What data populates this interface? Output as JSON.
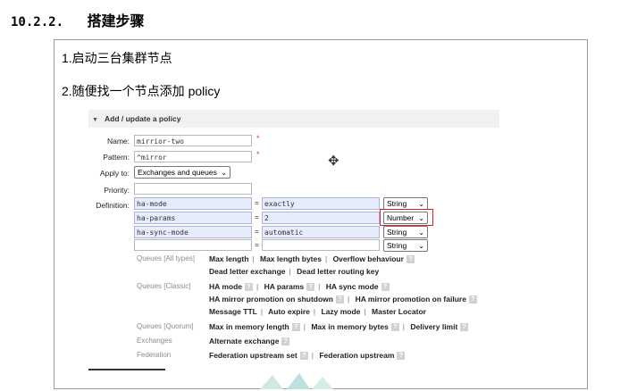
{
  "heading": {
    "number": "10.2.2.",
    "title": "搭建步骤"
  },
  "steps": [
    "1.启动三台集群节点",
    "2.随便找一个节点添加 policy"
  ],
  "panel": {
    "title": "Add / update a policy"
  },
  "form": {
    "name_label": "Name:",
    "name_value": "mirrior-two",
    "pattern_label": "Pattern:",
    "pattern_value": "^mirror",
    "required_mark": "*",
    "apply_label": "Apply to:",
    "apply_value": "Exchanges and queues",
    "priority_label": "Priority:",
    "priority_value": "",
    "definition_label": "Definition:",
    "definitions": [
      {
        "key": "ha-mode",
        "value": "exactly",
        "type": "String"
      },
      {
        "key": "ha-params",
        "value": "2",
        "type": "Number"
      },
      {
        "key": "ha-sync-mode",
        "value": "automatic",
        "type": "String"
      },
      {
        "key": "",
        "value": "",
        "type": "String"
      }
    ],
    "equals": "="
  },
  "option_groups": [
    {
      "category": "Queues [All types]",
      "lines": [
        [
          "Max length",
          "Max length bytes",
          "Overflow behaviour ?"
        ],
        [
          "Dead letter exchange",
          "Dead letter routing key"
        ]
      ]
    },
    {
      "category": "Queues [Classic]",
      "lines": [
        [
          "HA mode ?",
          "HA params ?",
          "HA sync mode ?"
        ],
        [
          "HA mirror promotion on shutdown ?",
          "HA mirror promotion on failure ?"
        ],
        [
          "Message TTL",
          "Auto expire",
          "Lazy mode",
          "Master Locator"
        ]
      ]
    },
    {
      "category": "Queues [Quorum]",
      "lines": [
        [
          "Max in memory length ?",
          "Max in memory bytes ?",
          "Delivery limit ?"
        ]
      ]
    },
    {
      "category": "Exchanges",
      "lines": [
        [
          "Alternate exchange ?"
        ]
      ]
    },
    {
      "category": "Federation",
      "lines": [
        [
          "Federation upstream set ?",
          "Federation upstream ?"
        ]
      ]
    }
  ],
  "colors": {
    "highlight": "#e02020",
    "input_blue": "#e6ecfb",
    "category_gray": "#8c8c8c"
  },
  "icons": {
    "cursor": "move-cursor-icon",
    "collapse": "triangle-down-icon",
    "help": "help-icon"
  }
}
